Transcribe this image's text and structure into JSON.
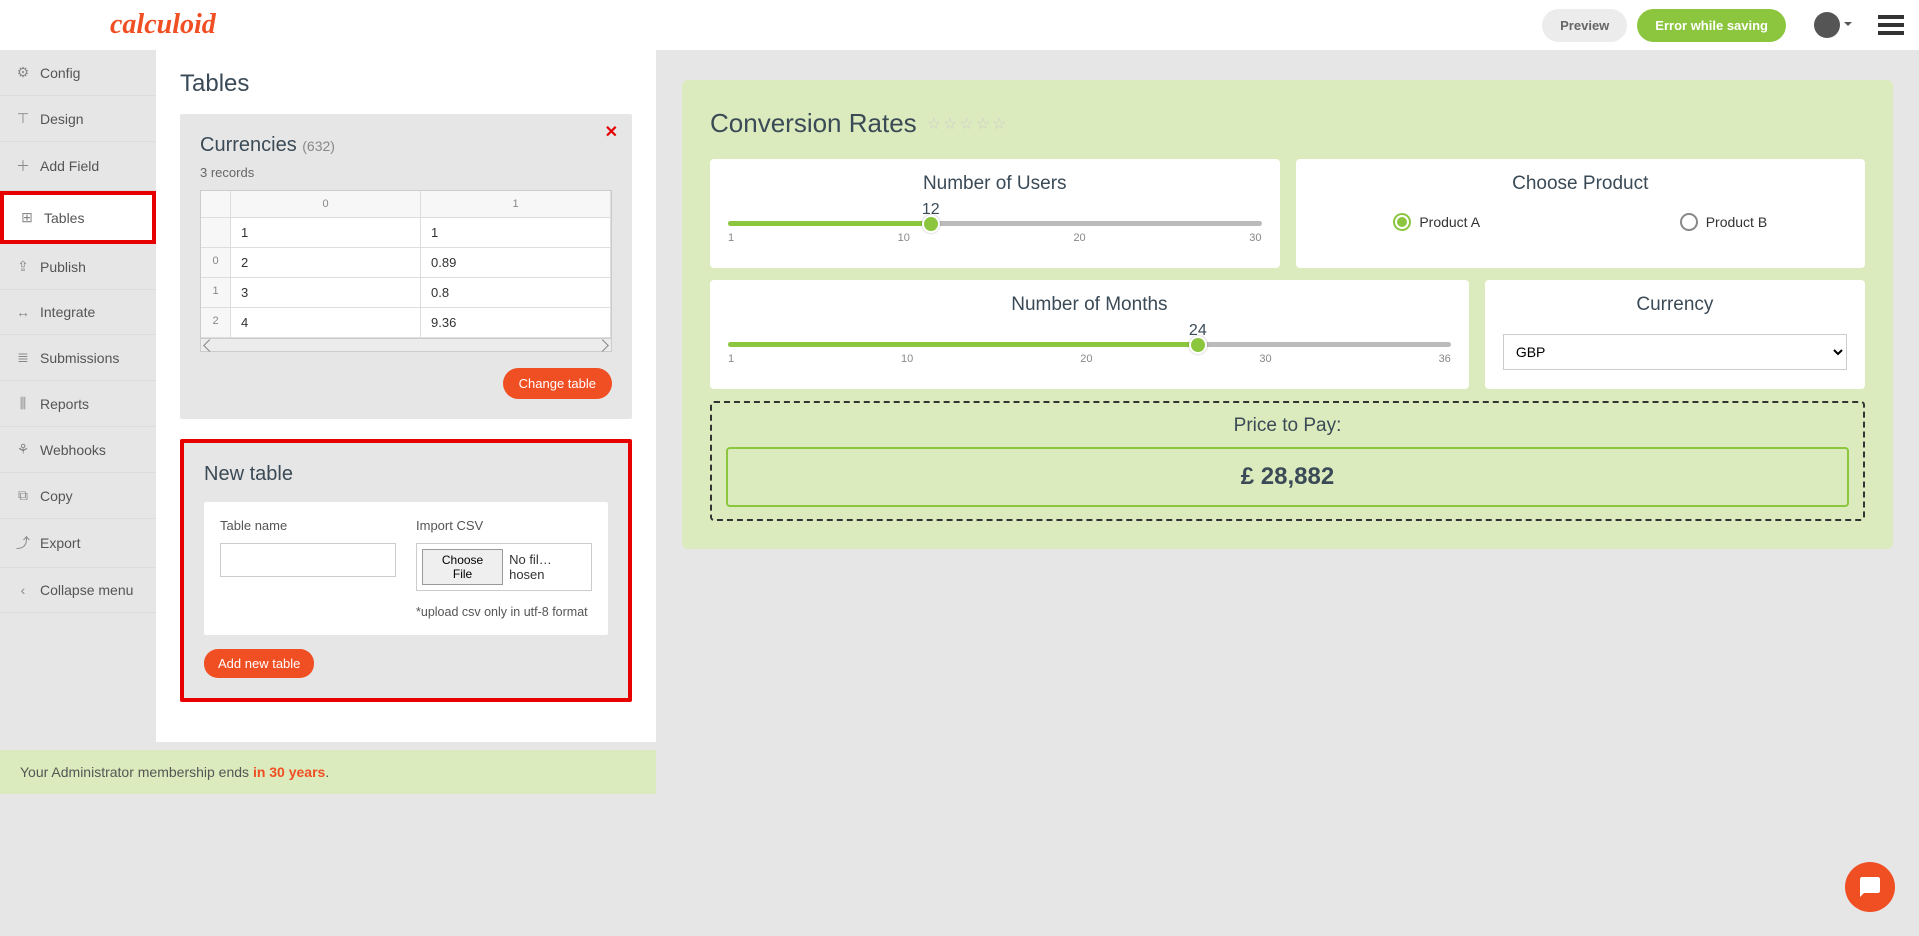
{
  "header": {
    "logo": "calculoid",
    "preview_label": "Preview",
    "save_label": "Error while saving"
  },
  "sidebar": {
    "items": [
      {
        "icon": "⚙",
        "label": "Config"
      },
      {
        "icon": "⊤",
        "label": "Design"
      },
      {
        "icon": "＋",
        "label": "Add Field"
      },
      {
        "icon": "⊞",
        "label": "Tables",
        "active": true,
        "highlighted": true
      },
      {
        "icon": "⇪",
        "label": "Publish"
      },
      {
        "icon": "↔",
        "label": "Integrate"
      },
      {
        "icon": "≣",
        "label": "Submissions"
      },
      {
        "icon": "⫼",
        "label": "Reports"
      },
      {
        "icon": "⚘",
        "label": "Webhooks"
      },
      {
        "icon": "⧉",
        "label": "Copy"
      },
      {
        "icon": "⤴",
        "label": "Export"
      },
      {
        "icon": "‹",
        "label": "Collapse menu"
      }
    ]
  },
  "tables_panel": {
    "heading": "Tables",
    "currencies": {
      "title": "Currencies",
      "count": "(632)",
      "records_label": "3 records",
      "col_headers": [
        "0",
        "1"
      ],
      "row_headers": [
        "",
        "0",
        "1",
        "2"
      ],
      "rows": [
        [
          "1",
          "1"
        ],
        [
          "2",
          "0.89"
        ],
        [
          "3",
          "0.8"
        ],
        [
          "4",
          "9.36"
        ]
      ],
      "change_btn": "Change table"
    },
    "new_table": {
      "title": "New table",
      "name_label": "Table name",
      "import_label": "Import CSV",
      "choose_file_label": "Choose File",
      "no_file_label": "No fil…hosen",
      "hint": "*upload csv only in utf-8 format",
      "add_btn": "Add new table"
    }
  },
  "preview": {
    "title": "Conversion Rates",
    "users": {
      "title": "Number of Users",
      "value": "12",
      "min": "1",
      "t2": "10",
      "t3": "20",
      "max": "30",
      "percent": 38
    },
    "product": {
      "title": "Choose Product",
      "opt_a": "Product A",
      "opt_b": "Product B"
    },
    "months": {
      "title": "Number of Months",
      "value": "24",
      "min": "1",
      "t2": "10",
      "t3": "20",
      "t4": "30",
      "max": "36",
      "percent": 65
    },
    "currency": {
      "title": "Currency",
      "value": "GBP"
    },
    "price": {
      "label": "Price to Pay:",
      "value": "£ 28,882"
    }
  },
  "footer": {
    "text": "Your Administrator membership ends ",
    "years": "in 30 years"
  }
}
